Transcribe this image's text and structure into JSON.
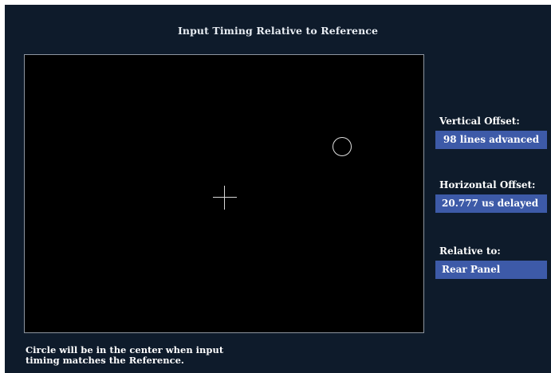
{
  "window": {
    "title": "Input Timing Relative to Reference"
  },
  "display": {
    "reference_marker": "crosshair",
    "input_marker": "circle"
  },
  "sidebar": {
    "vertical_offset": {
      "label": "Vertical Offset:",
      "value": "98 lines advanced"
    },
    "horizontal_offset": {
      "label": "Horizontal Offset:",
      "value": "20.777 us delayed"
    },
    "relative_to": {
      "label": "Relative to:",
      "value": "Rear Panel"
    }
  },
  "footer": {
    "line1": "Circle will be in the center when input",
    "line2": "timing matches the Reference."
  },
  "colors": {
    "background": "#0e1b2b",
    "plot_background": "#000000",
    "value_box": "#3d5aa8",
    "text": "#ffffff"
  }
}
